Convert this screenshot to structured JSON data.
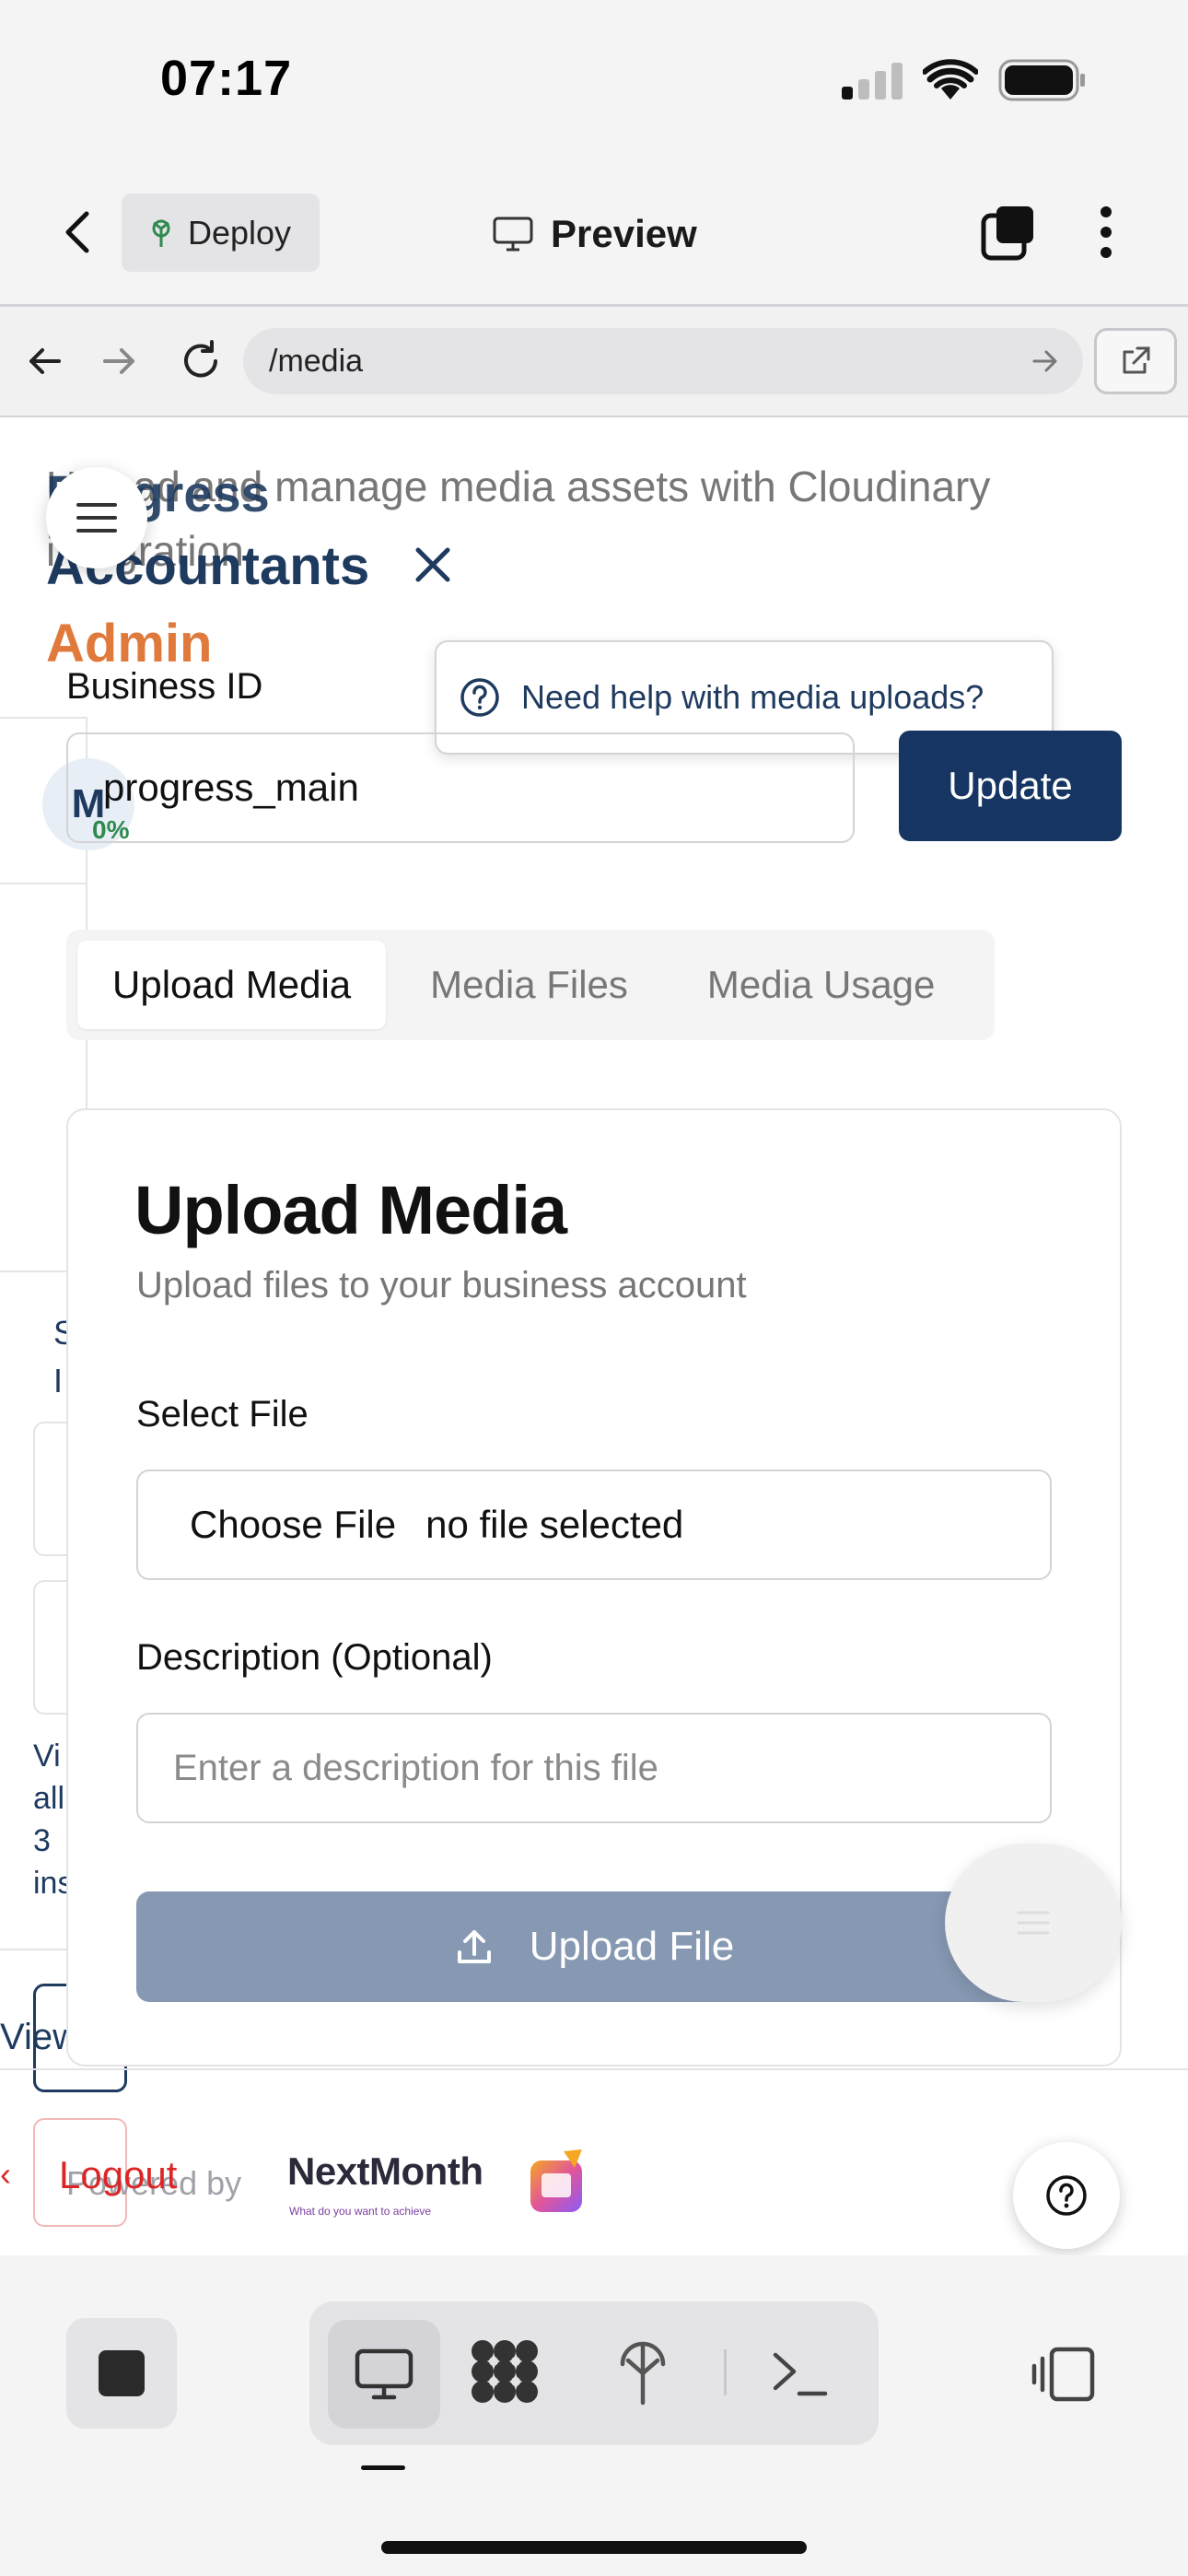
{
  "status_bar": {
    "time": "07:17"
  },
  "header": {
    "deploy_label": "Deploy",
    "preview_label": "Preview"
  },
  "urlbar": {
    "path": "/media"
  },
  "page": {
    "description": "Upload and manage media assets with Cloudinary integration",
    "brand_line1": "Progress",
    "brand_line2": "Accountants",
    "brand_role": "Admin",
    "avatar_initial": "M",
    "avatar_percent": "0%",
    "business_id_label": "Business ID",
    "business_id_value": "progress_main",
    "update_label": "Update",
    "help_bubble": "Need help with media uploads?",
    "tabs": [
      {
        "label": "Upload Media",
        "active": true
      },
      {
        "label": "Media Files",
        "active": false
      },
      {
        "label": "Media Usage",
        "active": false
      }
    ],
    "card": {
      "title": "Upload Media",
      "subtitle": "Upload files to your business account",
      "file_label": "Select File",
      "file_button": "Choose File",
      "file_status": "no file selected",
      "desc_label": "Description (Optional)",
      "desc_placeholder": "Enter a description for this file",
      "upload_label": "Upload File"
    },
    "sidebar_partial": {
      "s_text": "S\nI",
      "note": "Vi\nall\n3\nins",
      "view_text": "View",
      "logout_label": "Logout"
    },
    "footer": {
      "powered_by": "Powered by",
      "logo_text": "NextMonth",
      "logo_tag": "What do you want to achieve"
    }
  },
  "colors": {
    "primary": "#163562",
    "accent": "#e07a3c",
    "danger": "#dc2626",
    "upload_disabled": "#8698b2"
  }
}
